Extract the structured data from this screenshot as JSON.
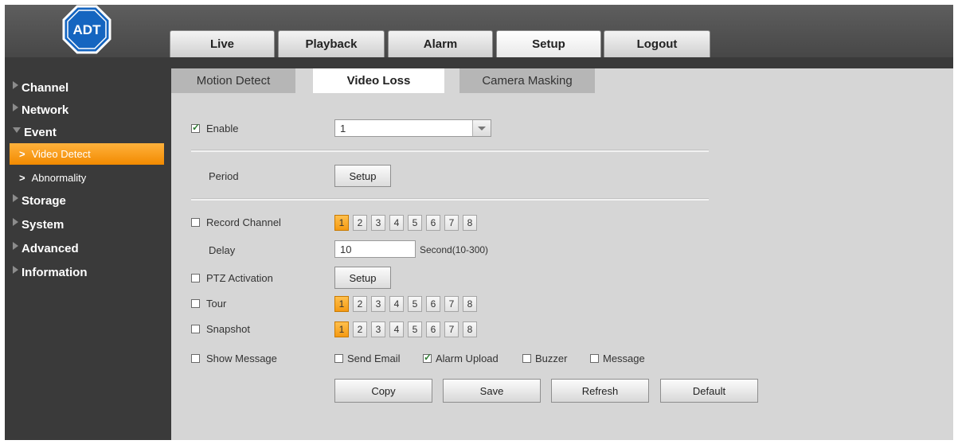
{
  "brand": {
    "logo_text": "ADT",
    "logo_color": "#1565c0"
  },
  "nav": {
    "tabs": [
      "Live",
      "Playback",
      "Alarm",
      "Setup",
      "Logout"
    ],
    "active": "Setup"
  },
  "sidebar": {
    "items": [
      {
        "label": "Channel"
      },
      {
        "label": "Network"
      },
      {
        "label": "Event",
        "expanded": true,
        "children": [
          {
            "label": "Video Detect",
            "active": true
          },
          {
            "label": "Abnormality"
          }
        ]
      },
      {
        "label": "Storage"
      },
      {
        "label": "System"
      },
      {
        "label": "Advanced"
      },
      {
        "label": "Information"
      }
    ],
    "accent_color": "#f59a12"
  },
  "subtabs": {
    "items": [
      "Motion Detect",
      "Video Loss",
      "Camera Masking"
    ],
    "active": "Video Loss"
  },
  "form": {
    "enable": {
      "label": "Enable",
      "checked": true,
      "select_value": "1"
    },
    "period": {
      "label": "Period",
      "button": "Setup"
    },
    "record_channel": {
      "label": "Record Channel",
      "checked": false,
      "channels": [
        "1",
        "2",
        "3",
        "4",
        "5",
        "6",
        "7",
        "8"
      ],
      "selected": "1"
    },
    "delay": {
      "label": "Delay",
      "value": "10",
      "unit": "Second(10-300)"
    },
    "ptz": {
      "label": "PTZ Activation",
      "checked": false,
      "button": "Setup"
    },
    "tour": {
      "label": "Tour",
      "checked": false,
      "channels": [
        "1",
        "2",
        "3",
        "4",
        "5",
        "6",
        "7",
        "8"
      ],
      "selected": "1"
    },
    "snapshot": {
      "label": "Snapshot",
      "checked": false,
      "channels": [
        "1",
        "2",
        "3",
        "4",
        "5",
        "6",
        "7",
        "8"
      ],
      "selected": "1"
    },
    "show_message": {
      "label": "Show Message",
      "checked": false
    },
    "send_email": {
      "label": "Send Email",
      "checked": false
    },
    "alarm_upload": {
      "label": "Alarm Upload",
      "checked": true
    },
    "buzzer": {
      "label": "Buzzer",
      "checked": false
    },
    "message": {
      "label": "Message",
      "checked": false
    }
  },
  "actions": {
    "copy": "Copy",
    "save": "Save",
    "refresh": "Refresh",
    "default": "Default"
  }
}
